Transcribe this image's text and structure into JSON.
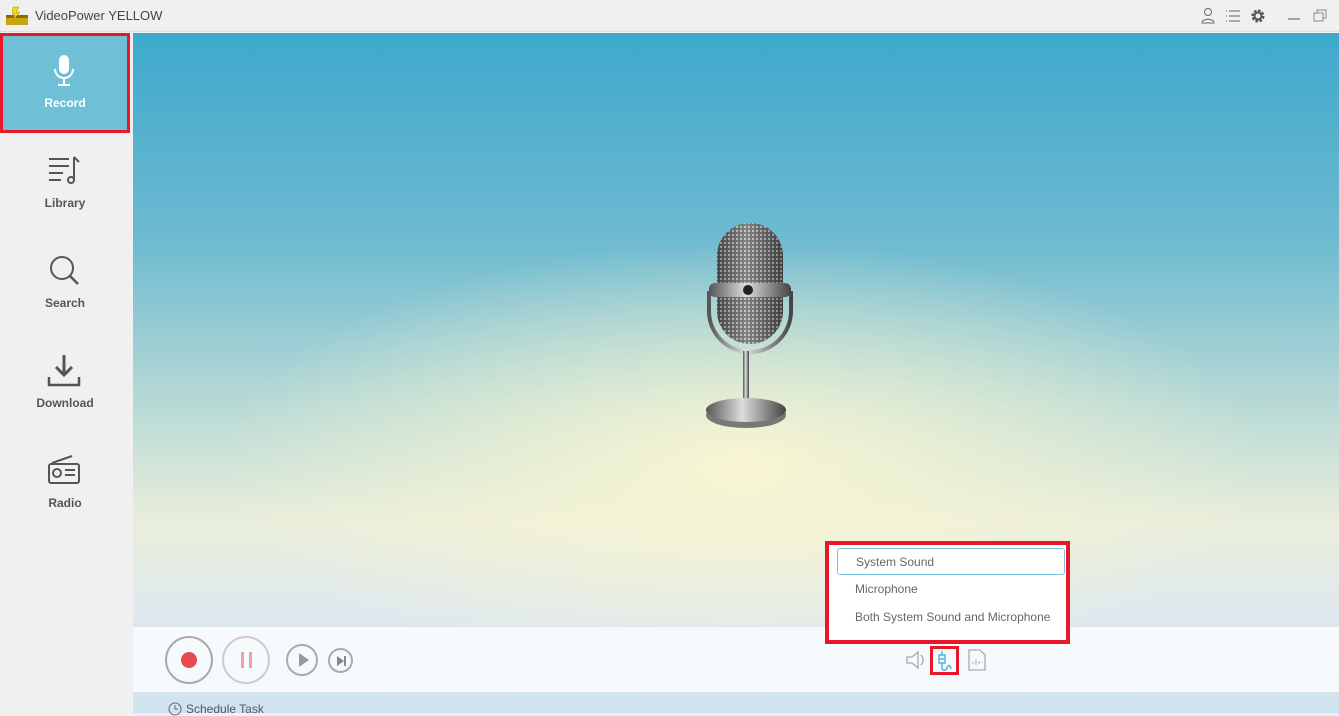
{
  "app": {
    "title": "VideoPower YELLOW"
  },
  "titlebar": {
    "icons": [
      "user-icon",
      "list-icon",
      "gear-icon",
      "minimize-icon",
      "restore-icon"
    ]
  },
  "sidebar": {
    "items": [
      {
        "label": "Record",
        "icon": "microphone-icon",
        "active": true
      },
      {
        "label": "Library",
        "icon": "music-list-icon"
      },
      {
        "label": "Search",
        "icon": "search-icon"
      },
      {
        "label": "Download",
        "icon": "download-icon"
      },
      {
        "label": "Radio",
        "icon": "radio-icon"
      }
    ]
  },
  "audio_source_menu": {
    "options": [
      "System Sound",
      "Microphone",
      "Both System Sound and Microphone"
    ],
    "selected": "System Sound"
  },
  "controls": {
    "record_color": "#e84a4f",
    "pause_color": "#f0a0a4"
  },
  "schedule": {
    "label": "Schedule Task"
  },
  "colors": {
    "accent": "#6fbfd6",
    "highlight": "#e8182a"
  }
}
